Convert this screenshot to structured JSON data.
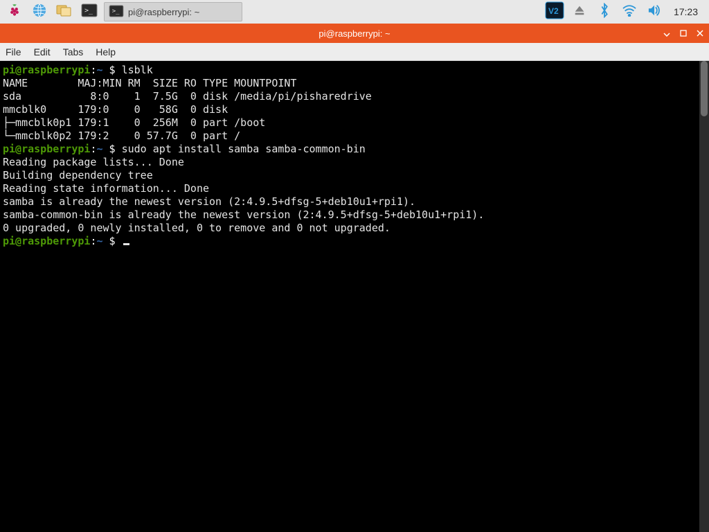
{
  "panel": {
    "taskbar_app_title": "pi@raspberrypi: ~",
    "clock": "17:23"
  },
  "window": {
    "title": "pi@raspberrypi: ~",
    "menu": {
      "file": "File",
      "edit": "Edit",
      "tabs": "Tabs",
      "help": "Help"
    }
  },
  "prompt": {
    "user_host": "pi@raspberrypi",
    "colon": ":",
    "cwd": "~",
    "dollar": " $ "
  },
  "terminal": {
    "cmd1": "lsblk",
    "lsblk_header": "NAME        MAJ:MIN RM  SIZE RO TYPE MOUNTPOINT",
    "lsblk_rows": [
      "sda           8:0    1  7.5G  0 disk /media/pi/pisharedrive",
      "mmcblk0     179:0    0   58G  0 disk ",
      "├─mmcblk0p1 179:1    0  256M  0 part /boot",
      "└─mmcblk0p2 179:2    0 57.7G  0 part /"
    ],
    "cmd2": "sudo apt install samba samba-common-bin",
    "apt_output": [
      "Reading package lists... Done",
      "Building dependency tree       ",
      "Reading state information... Done",
      "samba is already the newest version (2:4.9.5+dfsg-5+deb10u1+rpi1).",
      "samba-common-bin is already the newest version (2:4.9.5+dfsg-5+deb10u1+rpi1).",
      "0 upgraded, 0 newly installed, 0 to remove and 0 not upgraded."
    ]
  },
  "colors": {
    "titlebar": "#e95420",
    "prompt_user": "#4e9a06",
    "prompt_cwd": "#3465a4"
  },
  "icons": {
    "menu": "raspberry-logo-icon",
    "web": "globe-icon",
    "files": "file-manager-icon",
    "term_launcher": "terminal-icon",
    "task_term": "terminal-icon",
    "vnc": "vnc-icon",
    "eject": "eject-icon",
    "bluetooth": "bluetooth-icon",
    "wifi": "wifi-icon",
    "volume": "volume-icon",
    "win_min": "minimize-icon",
    "win_max": "maximize-icon",
    "win_close": "close-icon"
  }
}
